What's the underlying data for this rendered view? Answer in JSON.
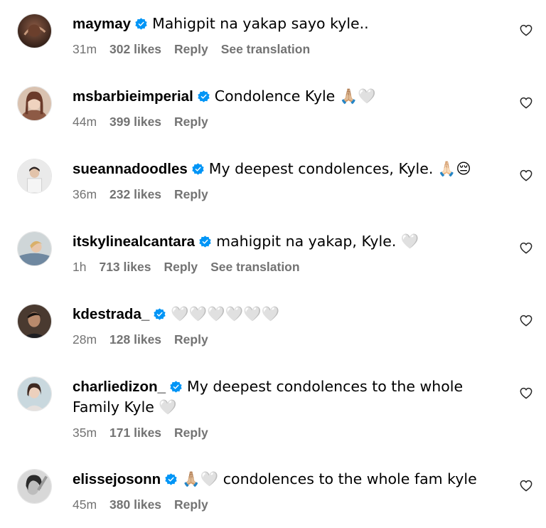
{
  "comments": [
    {
      "username": "maymay",
      "verified": true,
      "text": "Mahigpit na yakap sayo kyle..",
      "time": "31m",
      "likes": "302 likes",
      "reply": "Reply",
      "translation": "See translation",
      "avatar": "avatar-maymay"
    },
    {
      "username": "msbarbieimperial",
      "verified": true,
      "text": "Condolence Kyle 🙏🏼🤍",
      "time": "44m",
      "likes": "399 likes",
      "reply": "Reply",
      "translation": "",
      "avatar": "avatar-msbarbieimperial"
    },
    {
      "username": "sueannadoodles",
      "verified": true,
      "text": "My deepest condolences, Kyle. 🙏🏻😔",
      "time": "36m",
      "likes": "232 likes",
      "reply": "Reply",
      "translation": "",
      "avatar": "avatar-sueannadoodles"
    },
    {
      "username": "itskylinealcantara",
      "verified": true,
      "text": "mahigpit na yakap, Kyle. 🤍",
      "time": "1h",
      "likes": "713 likes",
      "reply": "Reply",
      "translation": "See translation",
      "avatar": "avatar-itskylinealcantara"
    },
    {
      "username": "kdestrada_",
      "verified": true,
      "text": "🤍🤍🤍🤍🤍🤍",
      "time": "28m",
      "likes": "128 likes",
      "reply": "Reply",
      "translation": "",
      "avatar": "avatar-kdestrada"
    },
    {
      "username": "charliedizon_",
      "verified": true,
      "text": "My deepest condolences to the whole Family Kyle 🤍",
      "time": "35m",
      "likes": "171 likes",
      "reply": "Reply",
      "translation": "",
      "avatar": "avatar-charliedizon"
    },
    {
      "username": "elissejosonn",
      "verified": true,
      "text": "🙏🏼🤍 condolences to the whole fam kyle",
      "time": "45m",
      "likes": "380 likes",
      "reply": "Reply",
      "translation": "",
      "avatar": "avatar-elissejosonn"
    }
  ],
  "icons": {
    "verified": "verified-badge-icon",
    "like": "heart-outline-icon"
  },
  "colors": {
    "verified": "#0095f6",
    "meta_text": "#737373",
    "text": "#000000"
  }
}
